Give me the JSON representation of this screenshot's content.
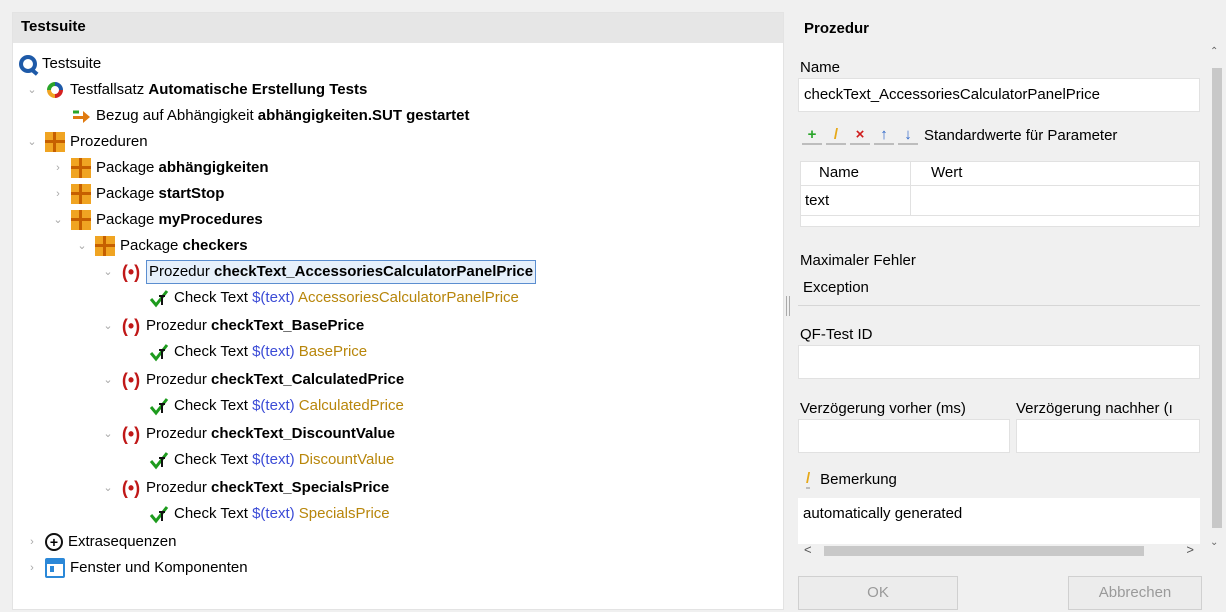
{
  "tree": {
    "header": "Testsuite",
    "root": "Testsuite",
    "testset_prefix": "Testfallsatz ",
    "testset_name": "Automatische Erstellung Tests",
    "dep_prefix": "Bezug auf Abhängigkeit ",
    "dep_name": "abhängigkeiten.SUT gestartet",
    "procedures": "Prozeduren",
    "pkg_prefix": "Package ",
    "pkg1": "abhängigkeiten",
    "pkg2": "startStop",
    "pkg3": "myProcedures",
    "pkg4": "checkers",
    "proc_prefix": "Prozedur ",
    "check_prefix": "Check Text ",
    "var": "$(text)",
    "proc1": "checkText_AccessoriesCalculatorPanelPrice",
    "arg1": "AccessoriesCalculatorPanelPrice",
    "proc2": "checkText_BasePrice",
    "arg2": "BasePrice",
    "proc3": "checkText_CalculatedPrice",
    "arg3": "CalculatedPrice",
    "proc4": "checkText_DiscountValue",
    "arg4": "DiscountValue",
    "proc5": "checkText_SpecialsPrice",
    "arg5": "SpecialsPrice",
    "extras": "Extrasequenzen",
    "windows": "Fenster und Komponenten"
  },
  "detail": {
    "title": "Prozedur",
    "name_label": "Name",
    "name_value": "checkText_AccessoriesCalculatorPanelPrice",
    "defaults_label": "Standardwerte für Parameter",
    "col_name": "Name",
    "col_value": "Wert",
    "param_name": "text",
    "param_value": "",
    "max_error_label": "Maximaler Fehler",
    "max_error_value": "Exception",
    "qftest_id_label": "QF-Test ID",
    "qftest_id_value": "",
    "delay_before_label": "Verzögerung vorher (ms)",
    "delay_after_label": "Verzögerung nachher (ı",
    "comment_label": "Bemerkung",
    "comment_value": "automatically generated",
    "ok_label": "OK",
    "cancel_label": "Abbrechen"
  },
  "icons": {
    "testsuite": "qf-testsuite-icon",
    "testset": "testset-icon",
    "dependency": "dependency-reference-icon",
    "package": "package-icon",
    "procedure": "procedure-icon",
    "check": "check-text-icon",
    "extras": "extras-plus-icon",
    "windows": "window-icon"
  }
}
